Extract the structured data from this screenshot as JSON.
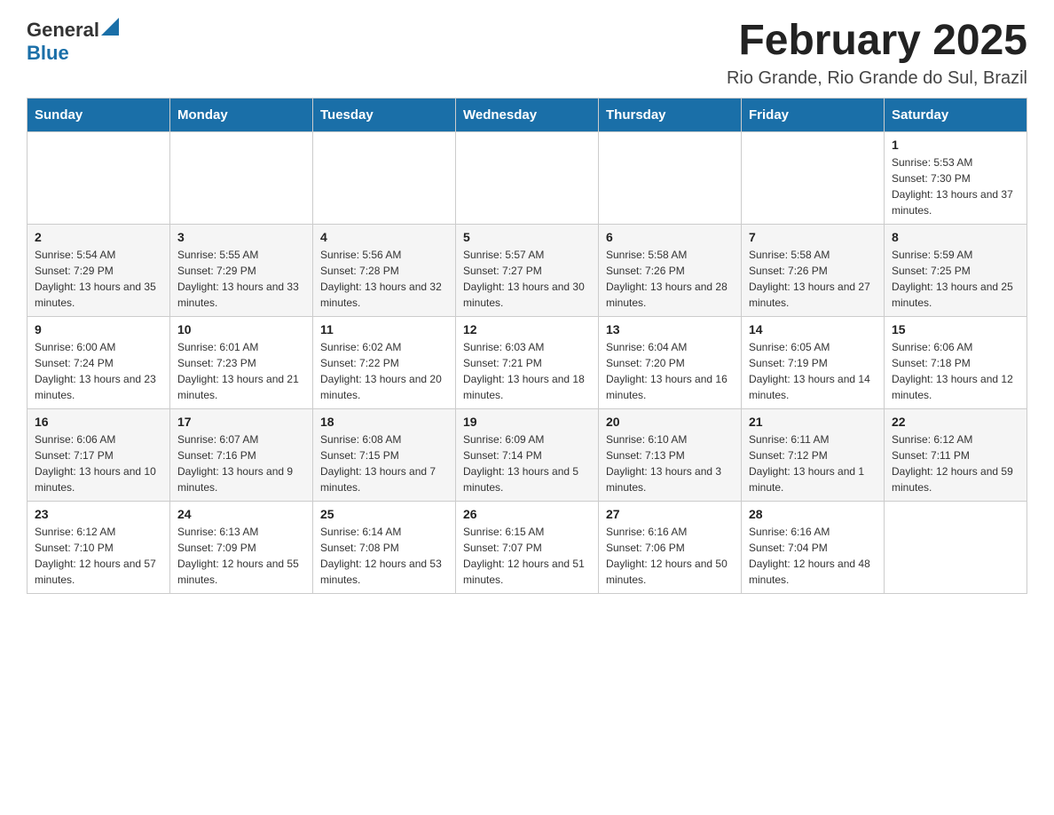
{
  "header": {
    "logo_general": "General",
    "logo_blue": "Blue",
    "title": "February 2025",
    "subtitle": "Rio Grande, Rio Grande do Sul, Brazil"
  },
  "calendar": {
    "days_of_week": [
      "Sunday",
      "Monday",
      "Tuesday",
      "Wednesday",
      "Thursday",
      "Friday",
      "Saturday"
    ],
    "weeks": [
      [
        {
          "day": "",
          "sunrise": "",
          "sunset": "",
          "daylight": ""
        },
        {
          "day": "",
          "sunrise": "",
          "sunset": "",
          "daylight": ""
        },
        {
          "day": "",
          "sunrise": "",
          "sunset": "",
          "daylight": ""
        },
        {
          "day": "",
          "sunrise": "",
          "sunset": "",
          "daylight": ""
        },
        {
          "day": "",
          "sunrise": "",
          "sunset": "",
          "daylight": ""
        },
        {
          "day": "",
          "sunrise": "",
          "sunset": "",
          "daylight": ""
        },
        {
          "day": "1",
          "sunrise": "Sunrise: 5:53 AM",
          "sunset": "Sunset: 7:30 PM",
          "daylight": "Daylight: 13 hours and 37 minutes."
        }
      ],
      [
        {
          "day": "2",
          "sunrise": "Sunrise: 5:54 AM",
          "sunset": "Sunset: 7:29 PM",
          "daylight": "Daylight: 13 hours and 35 minutes."
        },
        {
          "day": "3",
          "sunrise": "Sunrise: 5:55 AM",
          "sunset": "Sunset: 7:29 PM",
          "daylight": "Daylight: 13 hours and 33 minutes."
        },
        {
          "day": "4",
          "sunrise": "Sunrise: 5:56 AM",
          "sunset": "Sunset: 7:28 PM",
          "daylight": "Daylight: 13 hours and 32 minutes."
        },
        {
          "day": "5",
          "sunrise": "Sunrise: 5:57 AM",
          "sunset": "Sunset: 7:27 PM",
          "daylight": "Daylight: 13 hours and 30 minutes."
        },
        {
          "day": "6",
          "sunrise": "Sunrise: 5:58 AM",
          "sunset": "Sunset: 7:26 PM",
          "daylight": "Daylight: 13 hours and 28 minutes."
        },
        {
          "day": "7",
          "sunrise": "Sunrise: 5:58 AM",
          "sunset": "Sunset: 7:26 PM",
          "daylight": "Daylight: 13 hours and 27 minutes."
        },
        {
          "day": "8",
          "sunrise": "Sunrise: 5:59 AM",
          "sunset": "Sunset: 7:25 PM",
          "daylight": "Daylight: 13 hours and 25 minutes."
        }
      ],
      [
        {
          "day": "9",
          "sunrise": "Sunrise: 6:00 AM",
          "sunset": "Sunset: 7:24 PM",
          "daylight": "Daylight: 13 hours and 23 minutes."
        },
        {
          "day": "10",
          "sunrise": "Sunrise: 6:01 AM",
          "sunset": "Sunset: 7:23 PM",
          "daylight": "Daylight: 13 hours and 21 minutes."
        },
        {
          "day": "11",
          "sunrise": "Sunrise: 6:02 AM",
          "sunset": "Sunset: 7:22 PM",
          "daylight": "Daylight: 13 hours and 20 minutes."
        },
        {
          "day": "12",
          "sunrise": "Sunrise: 6:03 AM",
          "sunset": "Sunset: 7:21 PM",
          "daylight": "Daylight: 13 hours and 18 minutes."
        },
        {
          "day": "13",
          "sunrise": "Sunrise: 6:04 AM",
          "sunset": "Sunset: 7:20 PM",
          "daylight": "Daylight: 13 hours and 16 minutes."
        },
        {
          "day": "14",
          "sunrise": "Sunrise: 6:05 AM",
          "sunset": "Sunset: 7:19 PM",
          "daylight": "Daylight: 13 hours and 14 minutes."
        },
        {
          "day": "15",
          "sunrise": "Sunrise: 6:06 AM",
          "sunset": "Sunset: 7:18 PM",
          "daylight": "Daylight: 13 hours and 12 minutes."
        }
      ],
      [
        {
          "day": "16",
          "sunrise": "Sunrise: 6:06 AM",
          "sunset": "Sunset: 7:17 PM",
          "daylight": "Daylight: 13 hours and 10 minutes."
        },
        {
          "day": "17",
          "sunrise": "Sunrise: 6:07 AM",
          "sunset": "Sunset: 7:16 PM",
          "daylight": "Daylight: 13 hours and 9 minutes."
        },
        {
          "day": "18",
          "sunrise": "Sunrise: 6:08 AM",
          "sunset": "Sunset: 7:15 PM",
          "daylight": "Daylight: 13 hours and 7 minutes."
        },
        {
          "day": "19",
          "sunrise": "Sunrise: 6:09 AM",
          "sunset": "Sunset: 7:14 PM",
          "daylight": "Daylight: 13 hours and 5 minutes."
        },
        {
          "day": "20",
          "sunrise": "Sunrise: 6:10 AM",
          "sunset": "Sunset: 7:13 PM",
          "daylight": "Daylight: 13 hours and 3 minutes."
        },
        {
          "day": "21",
          "sunrise": "Sunrise: 6:11 AM",
          "sunset": "Sunset: 7:12 PM",
          "daylight": "Daylight: 13 hours and 1 minute."
        },
        {
          "day": "22",
          "sunrise": "Sunrise: 6:12 AM",
          "sunset": "Sunset: 7:11 PM",
          "daylight": "Daylight: 12 hours and 59 minutes."
        }
      ],
      [
        {
          "day": "23",
          "sunrise": "Sunrise: 6:12 AM",
          "sunset": "Sunset: 7:10 PM",
          "daylight": "Daylight: 12 hours and 57 minutes."
        },
        {
          "day": "24",
          "sunrise": "Sunrise: 6:13 AM",
          "sunset": "Sunset: 7:09 PM",
          "daylight": "Daylight: 12 hours and 55 minutes."
        },
        {
          "day": "25",
          "sunrise": "Sunrise: 6:14 AM",
          "sunset": "Sunset: 7:08 PM",
          "daylight": "Daylight: 12 hours and 53 minutes."
        },
        {
          "day": "26",
          "sunrise": "Sunrise: 6:15 AM",
          "sunset": "Sunset: 7:07 PM",
          "daylight": "Daylight: 12 hours and 51 minutes."
        },
        {
          "day": "27",
          "sunrise": "Sunrise: 6:16 AM",
          "sunset": "Sunset: 7:06 PM",
          "daylight": "Daylight: 12 hours and 50 minutes."
        },
        {
          "day": "28",
          "sunrise": "Sunrise: 6:16 AM",
          "sunset": "Sunset: 7:04 PM",
          "daylight": "Daylight: 12 hours and 48 minutes."
        },
        {
          "day": "",
          "sunrise": "",
          "sunset": "",
          "daylight": ""
        }
      ]
    ]
  }
}
